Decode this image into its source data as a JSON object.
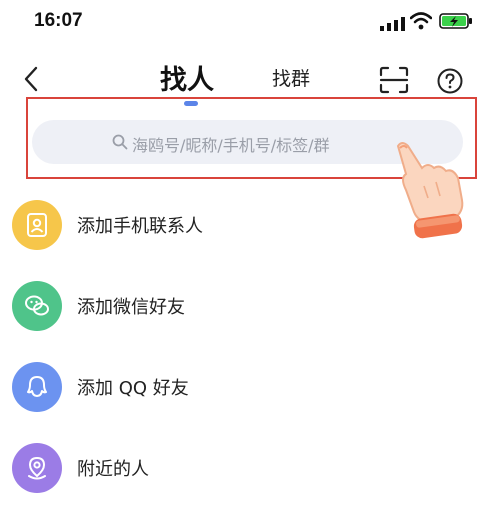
{
  "status_bar": {
    "time": "16:07"
  },
  "header": {
    "tab_active": "找人",
    "tab_other": "找群"
  },
  "search": {
    "placeholder": "海鸥号/昵称/手机号/标签/群"
  },
  "menu": {
    "items": [
      {
        "label": "添加手机联系人",
        "icon": "contacts-icon",
        "color": "#f6c64a"
      },
      {
        "label": "添加微信好友",
        "icon": "wechat-icon",
        "color": "#4fc48a"
      },
      {
        "label": "添加 QQ 好友",
        "icon": "qq-icon",
        "color": "#6c93f0"
      },
      {
        "label": "附近的人",
        "icon": "location-icon",
        "color": "#9b7ce6"
      }
    ]
  },
  "colors": {
    "accent": "#5b84e8",
    "highlight_border": "#d9443b",
    "search_bg": "#eef0f6",
    "battery": "#3bd14b"
  }
}
